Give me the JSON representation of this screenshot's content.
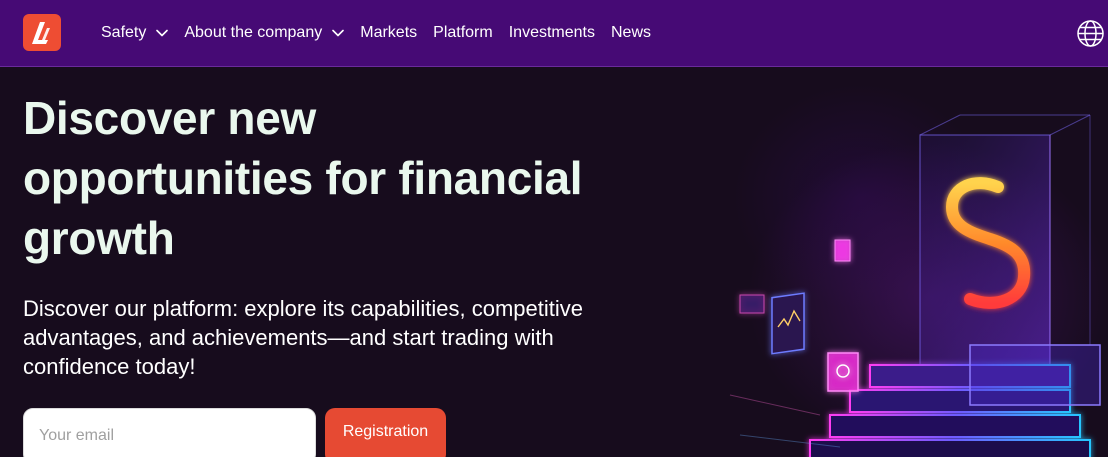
{
  "navbar": {
    "logo_icon": "brand-logo",
    "items": [
      {
        "label": "Safety",
        "has_dropdown": true
      },
      {
        "label": "About the company",
        "has_dropdown": true
      },
      {
        "label": "Markets",
        "has_dropdown": false
      },
      {
        "label": "Platform",
        "has_dropdown": false
      },
      {
        "label": "Investments",
        "has_dropdown": false
      },
      {
        "label": "News",
        "has_dropdown": false
      }
    ],
    "language_icon": "globe-icon"
  },
  "hero": {
    "headline": "Discover new opportunities for financial growth",
    "subtitle": "Discover our platform: explore its capabilities, competitive advantages, and achievements—and start trading with confidence today!",
    "email_placeholder": "Your email",
    "register_label": "Registration",
    "illustration_icon": "dollar-sign-illustration"
  },
  "colors": {
    "navbar_bg": "#460a75",
    "page_bg": "#170c1d",
    "accent": "#e64a33",
    "headline": "#eaf8ee"
  }
}
